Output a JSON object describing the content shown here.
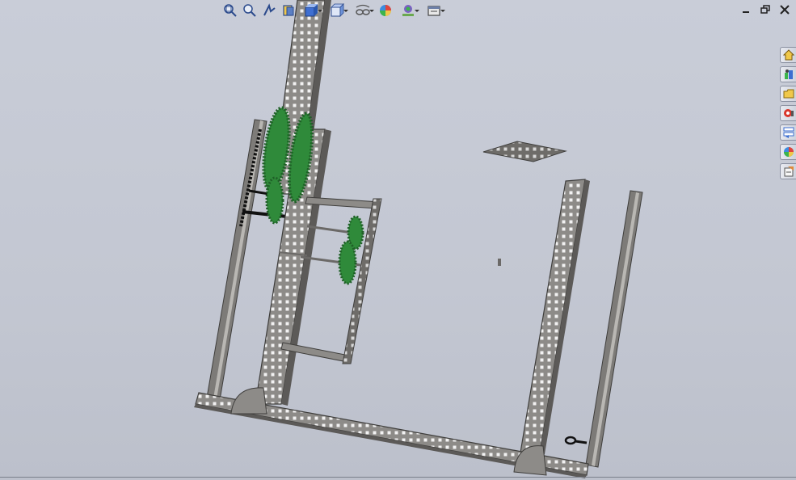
{
  "toolbar": {
    "items": [
      {
        "id": "zoom-to-fit",
        "icon": "zoom-to-fit-icon"
      },
      {
        "id": "zoom-to-area",
        "icon": "zoom-to-area-icon"
      },
      {
        "id": "previous-view",
        "icon": "previous-view-icon"
      },
      {
        "id": "section-view",
        "icon": "section-view-icon"
      },
      {
        "id": "view-orientation",
        "icon": "view-orientation-icon",
        "dropdown": true
      },
      {
        "id": "display-style",
        "icon": "display-style-icon",
        "dropdown": true
      },
      {
        "id": "hide-show-items",
        "icon": "hide-show-items-icon",
        "dropdown": true
      },
      {
        "id": "edit-appearance",
        "icon": "edit-appearance-icon"
      },
      {
        "id": "apply-scene",
        "icon": "apply-scene-icon",
        "dropdown": true
      },
      {
        "id": "view-settings",
        "icon": "view-settings-icon",
        "dropdown": true
      }
    ]
  },
  "window_controls": [
    "minimize-icon",
    "restore-icon",
    "close-icon"
  ],
  "task_pane": {
    "tabs": [
      {
        "id": "solidworks-resources",
        "icon": "home-icon"
      },
      {
        "id": "design-library",
        "icon": "design-library-icon"
      },
      {
        "id": "file-explorer",
        "icon": "folder-icon"
      },
      {
        "id": "search",
        "icon": "search-icon"
      },
      {
        "id": "view-palette",
        "icon": "view-palette-icon"
      },
      {
        "id": "appearances-scenes",
        "icon": "appearances-icon"
      },
      {
        "id": "custom-properties",
        "icon": "custom-properties-icon"
      }
    ]
  },
  "colors": {
    "background": "#c5c9d4",
    "metal": "#8a8886",
    "metal_dark": "#4e4c4a",
    "gear": "#2f8a3a",
    "gear_dark": "#1f5f27"
  }
}
